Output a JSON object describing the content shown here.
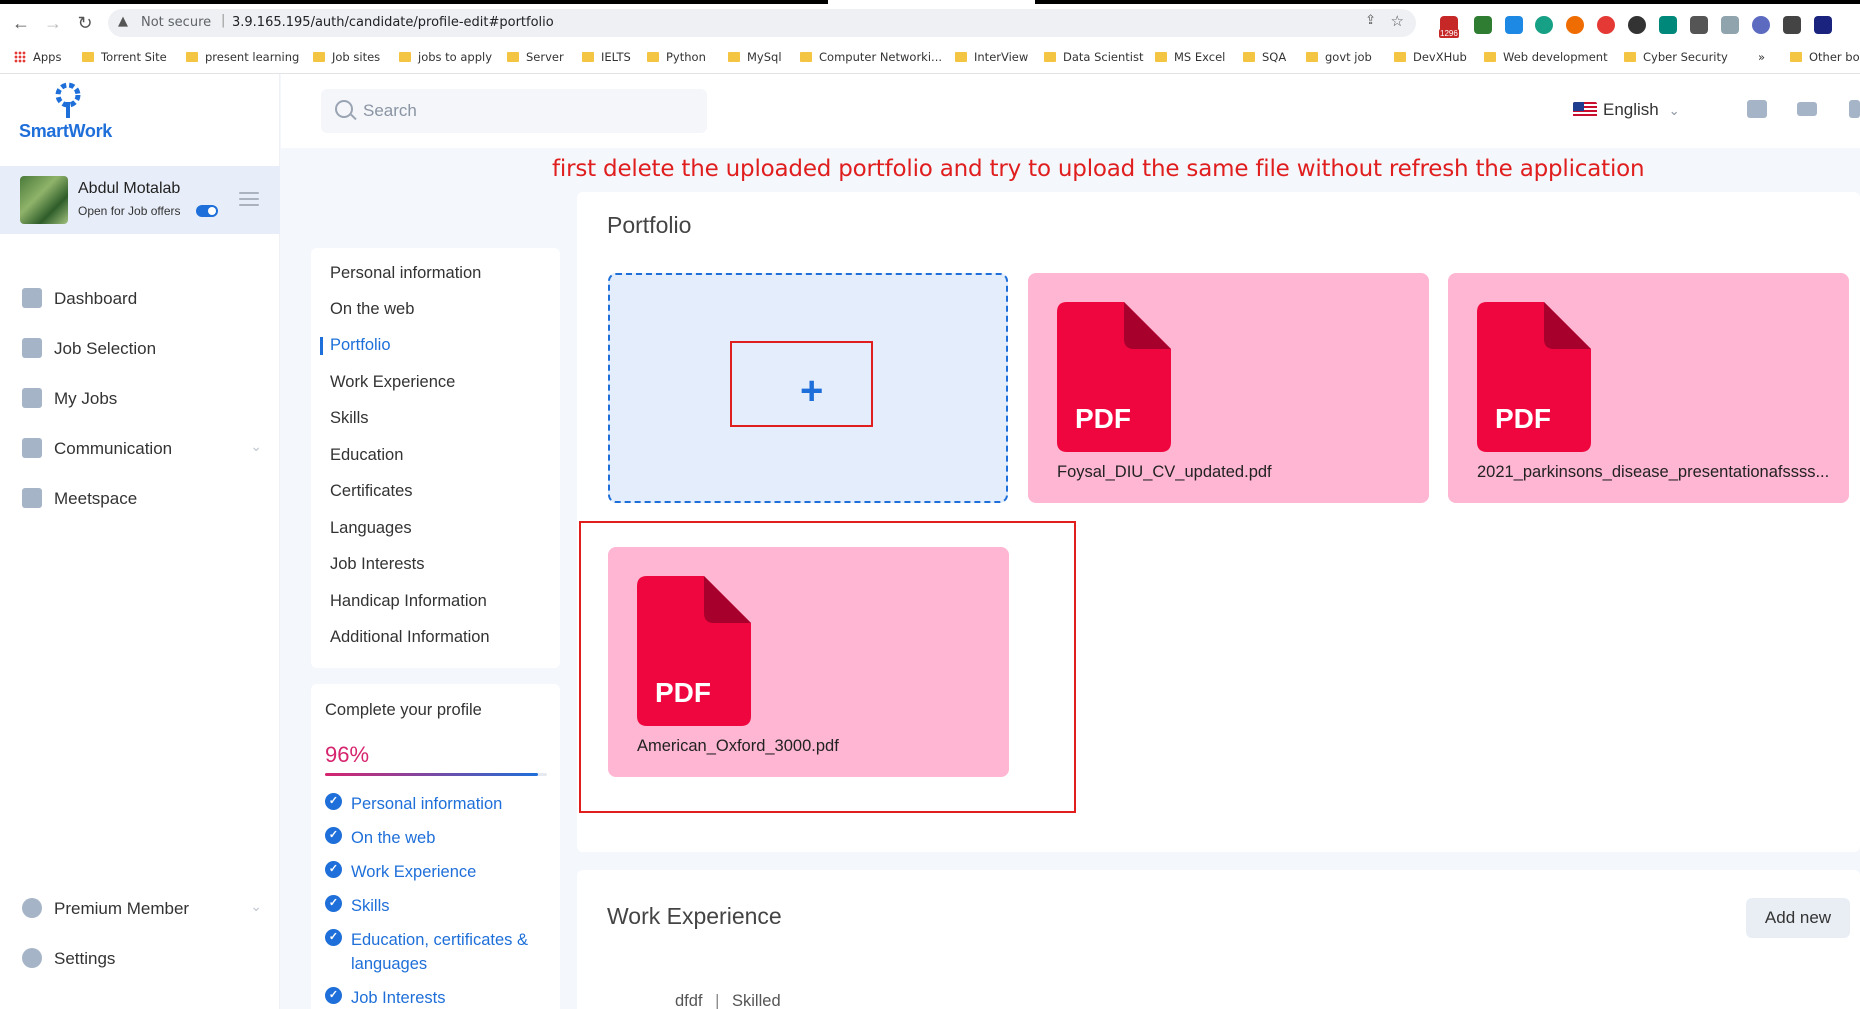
{
  "browser": {
    "security_label": "Not secure",
    "separator": "|",
    "url": "3.9.165.195/auth/candidate/profile-edit#portfolio",
    "bookmarks": [
      "Apps",
      "Torrent Site",
      "present learning",
      "Job sites",
      "jobs to apply",
      "Server",
      "IELTS",
      "Python",
      "MySql",
      "Computer Networki...",
      "InterView",
      "Data Scientist",
      "MS Excel",
      "SQA",
      "govt job",
      "DevXHub",
      "Web development",
      "Cyber Security",
      "Other bo"
    ],
    "overflow": "»",
    "mail_count": "1296"
  },
  "app": {
    "logo_text": "SmartWork"
  },
  "user": {
    "name": "Abdul Motalab",
    "status": "Open for Job offers",
    "open_for_offers": true
  },
  "sidebar": {
    "items": [
      {
        "label": "Dashboard",
        "icon": "dashboard-icon"
      },
      {
        "label": "Job Selection",
        "icon": "briefcase-icon"
      },
      {
        "label": "My Jobs",
        "icon": "bag-icon"
      },
      {
        "label": "Communication",
        "icon": "chat-icon",
        "expandable": true
      },
      {
        "label": "Meetspace",
        "icon": "meetspace-icon"
      }
    ],
    "bottom": [
      {
        "label": "Premium Member",
        "icon": "premium-icon",
        "expandable": true
      },
      {
        "label": "Settings",
        "icon": "gear-icon"
      }
    ]
  },
  "header": {
    "search_placeholder": "Search",
    "language": "English"
  },
  "annotation": "first delete the uploaded portfolio and try to upload the same file without refresh the application",
  "profile_nav": {
    "items": [
      "Personal information",
      "On the web",
      "Portfolio",
      "Work Experience",
      "Skills",
      "Education",
      "Certificates",
      "Languages",
      "Job Interests",
      "Handicap Information",
      "Additional Information"
    ],
    "active": "Portfolio"
  },
  "completion": {
    "title": "Complete your profile",
    "percent_label": "96%",
    "percent": 96,
    "items": [
      "Personal information",
      "On the web",
      "Work Experience",
      "Skills",
      "Education, certificates & languages",
      "Job Interests"
    ]
  },
  "portfolio": {
    "title": "Portfolio",
    "upload_symbol": "+",
    "files": [
      {
        "name": "Foysal_DIU_CV_updated.pdf",
        "badge": "PDF"
      },
      {
        "name": "2021_parkinsons_disease_presentationafssss...",
        "badge": "PDF"
      },
      {
        "name": "American_Oxford_3000.pdf",
        "badge": "PDF"
      }
    ]
  },
  "work_experience": {
    "title": "Work Experience",
    "add_label": "Add new",
    "row": {
      "company": "dfdf",
      "separator": "|",
      "level": "Skilled"
    }
  },
  "colors": {
    "accent": "#1e6fd9",
    "pdf_red": "#f0063f",
    "card_pink": "#ffb6d2",
    "annotation_red": "#e01e1e"
  }
}
